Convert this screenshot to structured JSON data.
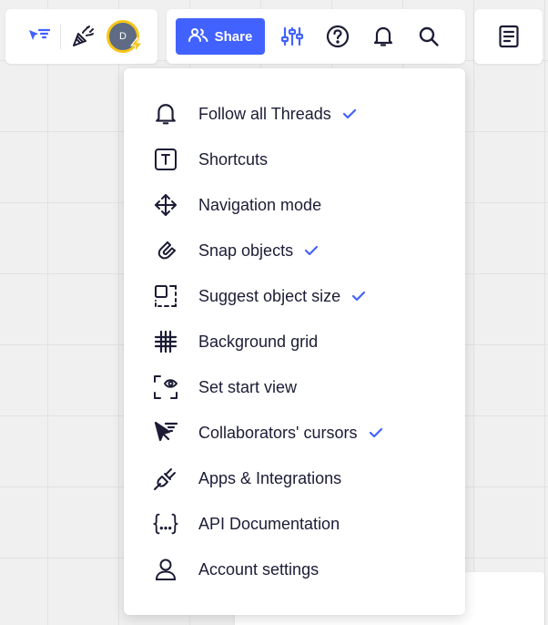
{
  "toolbar": {
    "avatar_initial": "D",
    "share_label": "Share",
    "left_icons": [
      "collaborators-filter-icon",
      "party-popper-icon"
    ],
    "right_icons": [
      "settings-sliders-icon",
      "help-icon",
      "bell-icon",
      "search-icon"
    ],
    "notes_icon": "notes-icon"
  },
  "menu": {
    "items": [
      {
        "label": "Follow all Threads",
        "icon": "bell-icon",
        "checked": true
      },
      {
        "label": "Shortcuts",
        "icon": "shortcut-key-icon",
        "checked": false
      },
      {
        "label": "Navigation mode",
        "icon": "move-arrows-icon",
        "checked": false
      },
      {
        "label": "Snap objects",
        "icon": "magnet-icon",
        "checked": true
      },
      {
        "label": "Suggest object size",
        "icon": "object-size-icon",
        "checked": true
      },
      {
        "label": "Background grid",
        "icon": "grid-icon",
        "checked": false
      },
      {
        "label": "Set start view",
        "icon": "eye-frame-icon",
        "checked": false
      },
      {
        "label": "Collaborators' cursors",
        "icon": "cursor-icon",
        "checked": true
      },
      {
        "label": "Apps & Integrations",
        "icon": "plug-icon",
        "checked": false
      },
      {
        "label": "API Documentation",
        "icon": "braces-icon",
        "checked": false
      },
      {
        "label": "Account settings",
        "icon": "user-icon",
        "checked": false
      }
    ]
  },
  "colors": {
    "accent": "#4262ff",
    "text": "#1c1c36",
    "avatar_ring": "#f5c518"
  }
}
